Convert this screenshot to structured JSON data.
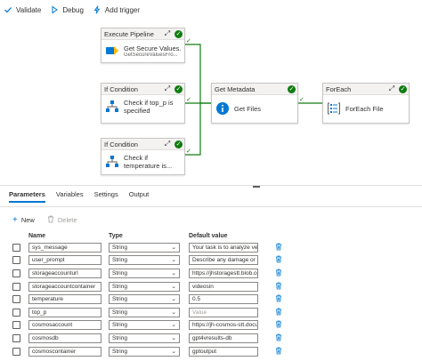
{
  "toolbar": {
    "validate_label": "Validate",
    "debug_label": "Debug",
    "add_trigger_label": "Add trigger"
  },
  "activities": {
    "execute_pipeline": {
      "title": "Execute Pipeline",
      "name": "Get Secure Values...",
      "sub": "GetSecureValuesFro..."
    },
    "if_condition_1": {
      "title": "If Condition",
      "name": "Check if top_p is specified"
    },
    "if_condition_2": {
      "title": "If Condition",
      "name": "Check if temperature is..."
    },
    "get_metadata": {
      "title": "Get Metadata",
      "name": "Get Files"
    },
    "foreach": {
      "title": "ForEach",
      "name": "ForEach File"
    }
  },
  "tabs": [
    "Parameters",
    "Variables",
    "Settings",
    "Output"
  ],
  "actions": {
    "new_label": "New",
    "delete_label": "Delete"
  },
  "table": {
    "headers": {
      "name": "Name",
      "type": "Type",
      "default": "Default value"
    },
    "rows": [
      {
        "name": "sys_message",
        "type": "String",
        "default": "Your task is to analyze vehic",
        "placeholder": false
      },
      {
        "name": "user_prompt",
        "type": "String",
        "default": "Describe any damage or po",
        "placeholder": false
      },
      {
        "name": "storageaccounturl",
        "type": "String",
        "default": "https://jhstoragestt.blob.cor",
        "placeholder": false
      },
      {
        "name": "storageaccountcontainer",
        "type": "String",
        "default": "videosin",
        "placeholder": false
      },
      {
        "name": "temperature",
        "type": "String",
        "default": "0.5",
        "placeholder": false
      },
      {
        "name": "top_p",
        "type": "String",
        "default": "Value",
        "placeholder": true
      },
      {
        "name": "cosmosaccount",
        "type": "String",
        "default": "https://jh-cosmos-stt.docur",
        "placeholder": false
      },
      {
        "name": "cosmosdb",
        "type": "String",
        "default": "gpt4vresults-db",
        "placeholder": false
      },
      {
        "name": "cosmoscontainer",
        "type": "String",
        "default": "gptoutput",
        "placeholder": false
      }
    ]
  },
  "colors": {
    "accent": "#0078d4",
    "success": "#107c10",
    "connector": "#107c10"
  }
}
